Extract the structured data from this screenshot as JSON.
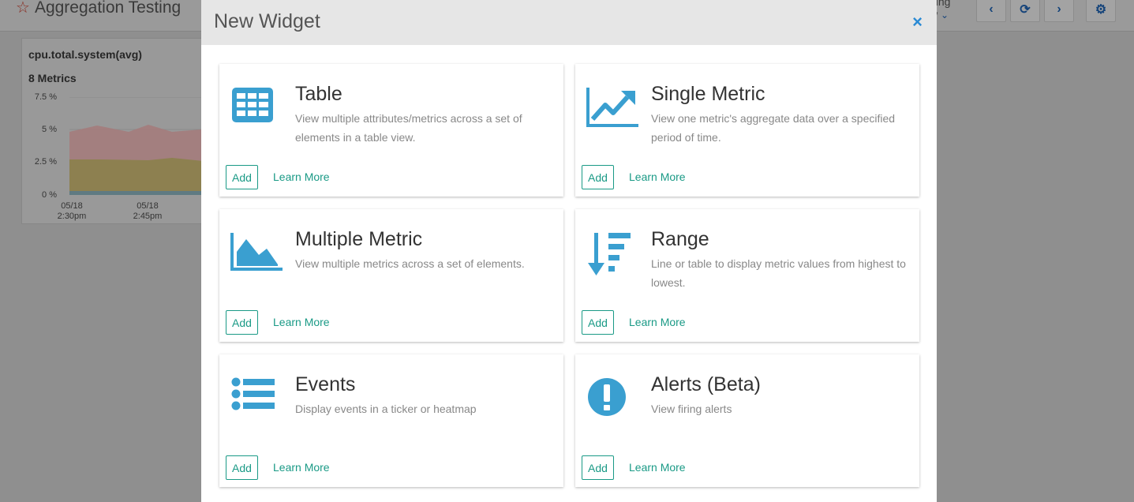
{
  "dashboard": {
    "title": "Aggregation Testing",
    "top_right_line1": "ding",
    "top_right_line2": "w",
    "card": {
      "metric_name": "cpu.total.system(avg)",
      "metric_count": "8 Metrics",
      "y_ticks": [
        "7.5 %",
        "5 %",
        "2.5 %",
        "0 %"
      ],
      "x_ticks": [
        {
          "date": "05/18",
          "time": "2:30pm"
        },
        {
          "date": "05/18",
          "time": "2:45pm"
        }
      ]
    }
  },
  "modal": {
    "title": "New Widget",
    "close_label": "×",
    "widgets": [
      {
        "title": "Table",
        "description": "View multiple attributes/metrics across a set of elements in a table view.",
        "add_label": "Add",
        "learn_label": "Learn More",
        "icon": "table-icon"
      },
      {
        "title": "Single Metric",
        "description": "View one metric's aggregate data over a specified period of time.",
        "add_label": "Add",
        "learn_label": "Learn More",
        "icon": "line-chart-icon"
      },
      {
        "title": "Multiple Metric",
        "description": "View multiple metrics across a set of elements.",
        "add_label": "Add",
        "learn_label": "Learn More",
        "icon": "area-chart-icon"
      },
      {
        "title": "Range",
        "description": "Line or table to display metric values from highest to lowest.",
        "add_label": "Add",
        "learn_label": "Learn More",
        "icon": "sort-desc-icon"
      },
      {
        "title": "Events",
        "description": "Display events in a ticker or heatmap",
        "add_label": "Add",
        "learn_label": "Learn More",
        "icon": "list-icon"
      },
      {
        "title": "Alerts (Beta)",
        "description": "View firing alerts",
        "add_label": "Add",
        "learn_label": "Learn More",
        "icon": "exclamation-circle-icon"
      }
    ]
  },
  "colors": {
    "accent": "#1a9a86",
    "icon_blue": "#3a9fd0",
    "close_blue": "#2a8ad4"
  }
}
